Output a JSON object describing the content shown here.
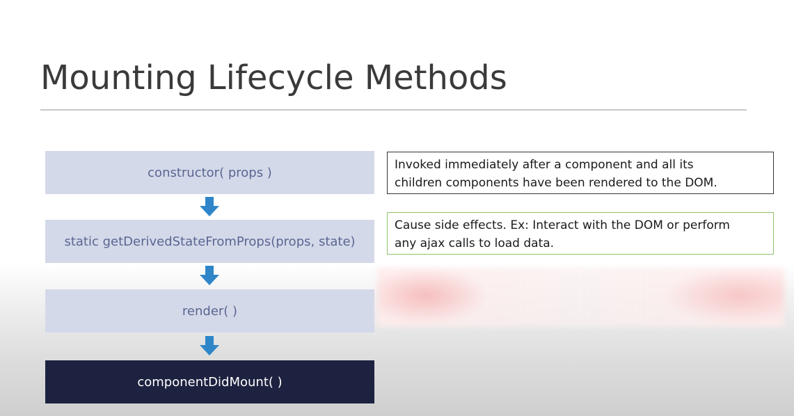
{
  "slide": {
    "title": "Mounting Lifecycle Methods"
  },
  "steps": [
    {
      "label": "constructor( props )"
    },
    {
      "label": "static getDerivedStateFromProps(props, state)"
    },
    {
      "label": "render( )"
    },
    {
      "label": "componentDidMount( )"
    }
  ],
  "notes": [
    {
      "lines": [
        "Invoked immediately after a component and all its",
        "children components have been rendered to the DOM."
      ]
    },
    {
      "lines": [
        "Cause side effects. Ex: Interact with the DOM or perform",
        "any ajax calls to load data."
      ]
    }
  ],
  "colors": {
    "step_fill": "#d4d9ea",
    "step_text": "#5a6690",
    "final_step_fill": "#1d2240",
    "arrow": "#2e86c9",
    "note1_border": "#333333",
    "note2_border": "#8fc16a"
  },
  "icons": {
    "arrow": "arrow-down-icon"
  }
}
